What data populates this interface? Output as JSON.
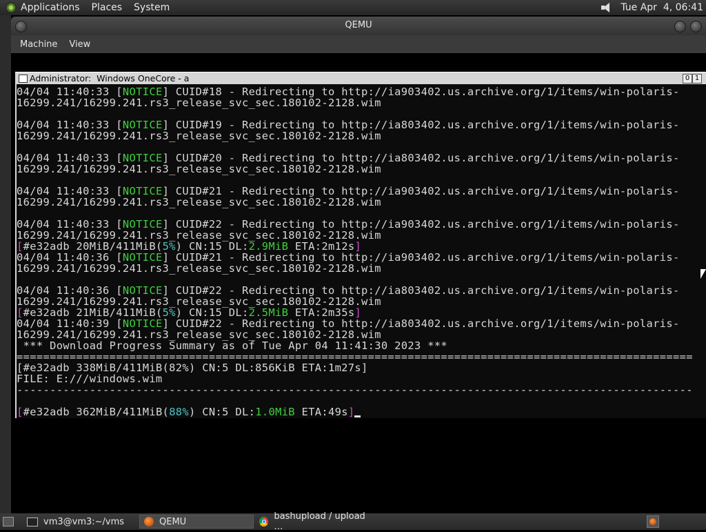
{
  "top_panel": {
    "menus": [
      "Applications",
      "Places",
      "System"
    ],
    "clock": "Tue Apr  4, 06:41"
  },
  "qemu": {
    "title": "QEMU",
    "menus": [
      "Machine",
      "View"
    ]
  },
  "console": {
    "title": "Administrator:  Windows OneCore - a",
    "button_labels": [
      "0",
      "1"
    ],
    "lines": [
      [
        {
          "t": "04/04 11:40:33 ["
        },
        {
          "t": "NOTICE",
          "c": "g"
        },
        {
          "t": "] CUID#18 - Redirecting to http://ia903402.us.archive.org/1/items/win-polaris-"
        }
      ],
      [
        {
          "t": "16299.241/16299.241.rs3_release_svc_sec.180102-2128.wim"
        }
      ],
      [],
      [
        {
          "t": "04/04 11:40:33 ["
        },
        {
          "t": "NOTICE",
          "c": "g"
        },
        {
          "t": "] CUID#19 - Redirecting to http://ia803402.us.archive.org/1/items/win-polaris-"
        }
      ],
      [
        {
          "t": "16299.241/16299.241.rs3_release_svc_sec.180102-2128.wim"
        }
      ],
      [],
      [
        {
          "t": "04/04 11:40:33 ["
        },
        {
          "t": "NOTICE",
          "c": "g"
        },
        {
          "t": "] CUID#20 - Redirecting to http://ia803402.us.archive.org/1/items/win-polaris-"
        }
      ],
      [
        {
          "t": "16299.241/16299.241.rs3_release_svc_sec.180102-2128.wim"
        }
      ],
      [],
      [
        {
          "t": "04/04 11:40:33 ["
        },
        {
          "t": "NOTICE",
          "c": "g"
        },
        {
          "t": "] CUID#21 - Redirecting to http://ia903402.us.archive.org/1/items/win-polaris-"
        }
      ],
      [
        {
          "t": "16299.241/16299.241.rs3_release_svc_sec.180102-2128.wim"
        }
      ],
      [],
      [
        {
          "t": "04/04 11:40:33 ["
        },
        {
          "t": "NOTICE",
          "c": "g"
        },
        {
          "t": "] CUID#22 - Redirecting to http://ia903402.us.archive.org/1/items/win-polaris-"
        }
      ],
      [
        {
          "t": "16299.241/16299.241.rs3_release_svc_sec.180102-2128.wim"
        }
      ],
      [
        {
          "t": "[",
          "c": "m"
        },
        {
          "t": "#e32adb 20MiB/411MiB("
        },
        {
          "t": "5%",
          "c": "c"
        },
        {
          "t": ") CN:15 DL:"
        },
        {
          "t": "2.9MiB",
          "c": "g"
        },
        {
          "t": " ETA:2m12s"
        },
        {
          "t": "]",
          "c": "m"
        }
      ],
      [
        {
          "t": "04/04 11:40:36 ["
        },
        {
          "t": "NOTICE",
          "c": "g"
        },
        {
          "t": "] CUID#21 - Redirecting to http://ia903402.us.archive.org/1/items/win-polaris-"
        }
      ],
      [
        {
          "t": "16299.241/16299.241.rs3_release_svc_sec.180102-2128.wim"
        }
      ],
      [],
      [
        {
          "t": "04/04 11:40:36 ["
        },
        {
          "t": "NOTICE",
          "c": "g"
        },
        {
          "t": "] CUID#22 - Redirecting to http://ia803402.us.archive.org/1/items/win-polaris-"
        }
      ],
      [
        {
          "t": "16299.241/16299.241.rs3_release_svc_sec.180102-2128.wim"
        }
      ],
      [
        {
          "t": "[",
          "c": "m"
        },
        {
          "t": "#e32adb 21MiB/411MiB("
        },
        {
          "t": "5%",
          "c": "c"
        },
        {
          "t": ") CN:15 DL:"
        },
        {
          "t": "2.5MiB",
          "c": "g"
        },
        {
          "t": " ETA:2m35s"
        },
        {
          "t": "]",
          "c": "m"
        }
      ],
      [
        {
          "t": "04/04 11:40:39 ["
        },
        {
          "t": "NOTICE",
          "c": "g"
        },
        {
          "t": "] CUID#22 - Redirecting to http://ia803402.us.archive.org/1/items/win-polaris-"
        }
      ],
      [
        {
          "t": "16299.241/16299.241.rs3_release_svc_sec.180102-2128.wim"
        }
      ],
      [
        {
          "t": " *** Download Progress Summary as of Tue Apr 04 11:41:30 2023 ***"
        }
      ],
      [
        {
          "t": "======================================================================================================"
        }
      ],
      [
        {
          "t": "[#e32adb 338MiB/411MiB(82%) CN:5 DL:856KiB ETA:1m27s]"
        }
      ],
      [
        {
          "t": "FILE: E:///windows.wim"
        }
      ],
      [
        {
          "t": "------------------------------------------------------------------------------------------------------"
        }
      ],
      [],
      [
        {
          "t": "[",
          "c": "m"
        },
        {
          "t": "#e32adb 362MiB/411MiB("
        },
        {
          "t": "88%",
          "c": "c"
        },
        {
          "t": ") CN:5 DL:"
        },
        {
          "t": "1.0MiB",
          "c": "g"
        },
        {
          "t": " ETA:49s"
        },
        {
          "t": "]",
          "c": "m"
        },
        {
          "cursor": true
        }
      ]
    ]
  },
  "taskbar": {
    "items": [
      {
        "label": "vm3@vm3:~/vms",
        "icon": "terminal-icon"
      },
      {
        "label": "QEMU",
        "icon": "qemu-icon"
      },
      {
        "label": "bashupload / upload …",
        "icon": "chrome-icon"
      }
    ]
  }
}
